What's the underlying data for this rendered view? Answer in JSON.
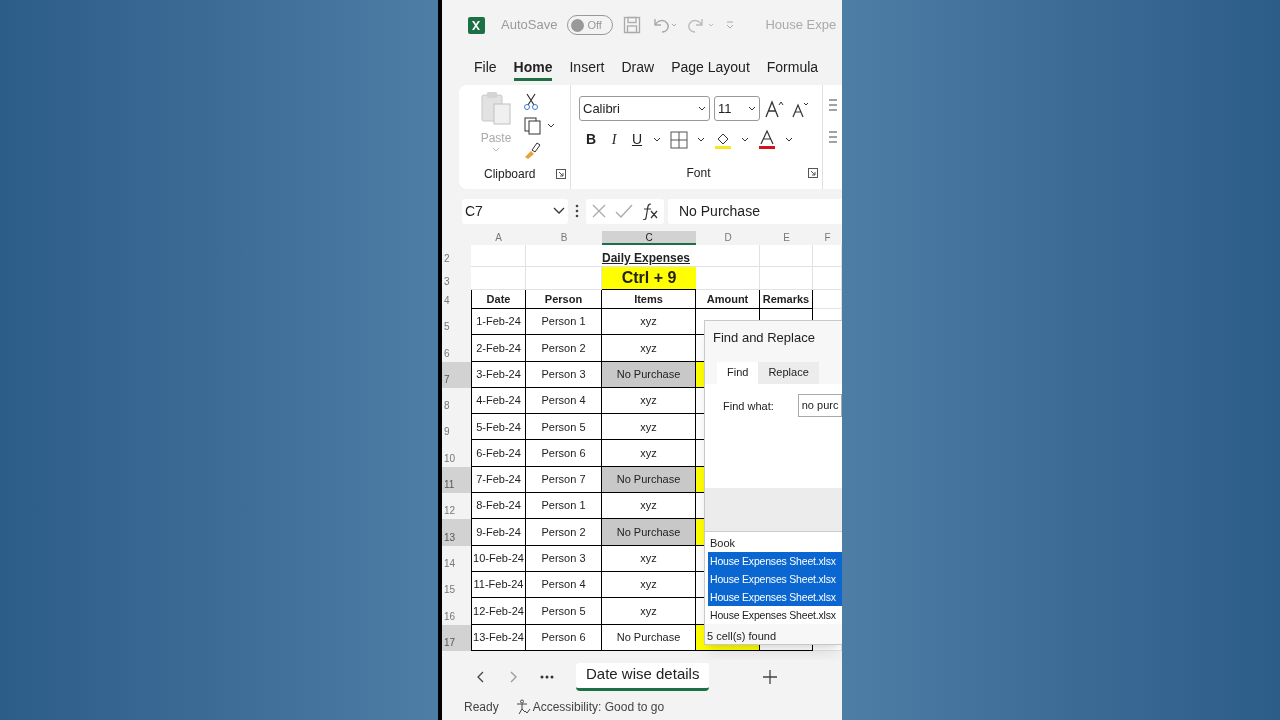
{
  "title_bar": {
    "autosave_label": "AutoSave",
    "autosave_on": false,
    "toggle_text": "Off",
    "document_title": "House Expe"
  },
  "ribbon_tabs": [
    {
      "label": "File",
      "selected": false
    },
    {
      "label": "Home",
      "selected": true
    },
    {
      "label": "Insert",
      "selected": false
    },
    {
      "label": "Draw",
      "selected": false
    },
    {
      "label": "Page Layout",
      "selected": false
    },
    {
      "label": "Formula",
      "selected": false
    }
  ],
  "ribbon": {
    "paste_label": "Paste",
    "font_name": "Calibri",
    "font_size": "11",
    "bold": "B",
    "italic": "I",
    "underline": "U",
    "groups": [
      "Clipboard",
      "Font"
    ]
  },
  "formula_bar": {
    "name_box": "C7",
    "value": "No Purchase"
  },
  "column_headers": [
    {
      "label": "A",
      "selected": false
    },
    {
      "label": "B",
      "selected": false
    },
    {
      "label": "C",
      "selected": true
    },
    {
      "label": "D",
      "selected": false
    },
    {
      "label": "E",
      "selected": false
    },
    {
      "label": "F",
      "selected": false
    }
  ],
  "sheet": {
    "title_row": "2",
    "title": "Daily Expenses",
    "shortcut_row": "3",
    "shortcut": "Ctrl + 9",
    "header_row": "4",
    "columns": [
      "Date",
      "Person",
      "Items",
      "Amount",
      "Remarks"
    ],
    "rows": [
      {
        "row_number": "5",
        "date": "1-Feb-24",
        "person": "Person 1",
        "item": "xyz",
        "selected": false,
        "item_shaded": false
      },
      {
        "row_number": "6",
        "date": "2-Feb-24",
        "person": "Person 2",
        "item": "xyz",
        "selected": false,
        "item_shaded": false
      },
      {
        "row_number": "7",
        "date": "3-Feb-24",
        "person": "Person 3",
        "item": "No Purchase",
        "selected": true,
        "item_shaded": true
      },
      {
        "row_number": "8",
        "date": "4-Feb-24",
        "person": "Person 4",
        "item": "xyz",
        "selected": false,
        "item_shaded": false
      },
      {
        "row_number": "9",
        "date": "5-Feb-24",
        "person": "Person 5",
        "item": "xyz",
        "selected": false,
        "item_shaded": false
      },
      {
        "row_number": "10",
        "date": "6-Feb-24",
        "person": "Person 6",
        "item": "xyz",
        "selected": false,
        "item_shaded": false
      },
      {
        "row_number": "11",
        "date": "7-Feb-24",
        "person": "Person 7",
        "item": "No Purchase",
        "selected": true,
        "item_shaded": true
      },
      {
        "row_number": "12",
        "date": "8-Feb-24",
        "person": "Person 1",
        "item": "xyz",
        "selected": false,
        "item_shaded": false
      },
      {
        "row_number": "13",
        "date": "9-Feb-24",
        "person": "Person 2",
        "item": "No Purchase",
        "selected": true,
        "item_shaded": true
      },
      {
        "row_number": "14",
        "date": "10-Feb-24",
        "person": "Person 3",
        "item": "xyz",
        "selected": false,
        "item_shaded": false
      },
      {
        "row_number": "15",
        "date": "11-Feb-24",
        "person": "Person 4",
        "item": "xyz",
        "selected": false,
        "item_shaded": false
      },
      {
        "row_number": "16",
        "date": "12-Feb-24",
        "person": "Person 5",
        "item": "xyz",
        "selected": false,
        "item_shaded": false
      },
      {
        "row_number": "17",
        "date": "13-Feb-24",
        "person": "Person 6",
        "item": "No Purchase",
        "selected": true,
        "item_shaded": false
      }
    ]
  },
  "find_dialog": {
    "title": "Find and Replace",
    "tabs": [
      {
        "label": "Find",
        "selected": true
      },
      {
        "label": "Replace",
        "selected": false
      }
    ],
    "find_label": "Find what:",
    "find_value": "no purc",
    "results_header": "Book",
    "results": [
      {
        "text": "House Expenses Sheet.xlsx",
        "selected": true
      },
      {
        "text": "House Expenses Sheet.xlsx",
        "selected": true
      },
      {
        "text": "House Expenses Sheet.xlsx",
        "selected": true
      },
      {
        "text": "House Expenses Sheet.xlsx",
        "selected": false
      }
    ],
    "status": "5 cell(s) found"
  },
  "sheet_tabs": [
    {
      "label": "Date wise details",
      "selected": true
    }
  ],
  "status_bar": {
    "mode": "Ready",
    "accessibility": "Accessibility: Good to go"
  }
}
